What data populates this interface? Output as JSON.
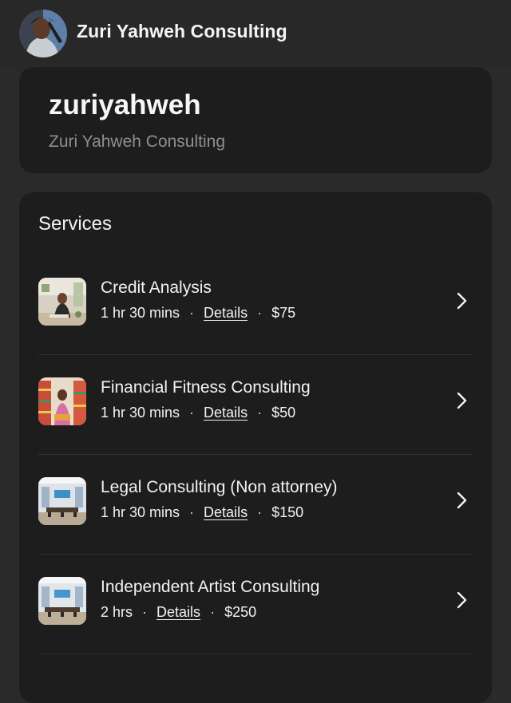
{
  "header": {
    "business_name": "Zuri Yahweh Consulting",
    "avatar_icon": "profile-photo"
  },
  "profile": {
    "username": "zuriyahweh",
    "display_name": "Zuri Yahweh Consulting"
  },
  "services": {
    "heading": "Services",
    "items": [
      {
        "name": "Credit Analysis",
        "duration": "1 hr 30 mins",
        "details_label": "Details",
        "price": "$75",
        "thumb": "woman-in-office"
      },
      {
        "name": "Financial Fitness Consulting",
        "duration": "1 hr 30 mins",
        "details_label": "Details",
        "price": "$50",
        "thumb": "woman-in-store"
      },
      {
        "name": "Legal Consulting (Non attorney)",
        "duration": "1 hr 30 mins",
        "details_label": "Details",
        "price": "$150",
        "thumb": "conference-room"
      },
      {
        "name": "Independent Artist Consulting",
        "duration": "2 hrs",
        "details_label": "Details",
        "price": "$250",
        "thumb": "conference-room"
      }
    ],
    "separator": "·"
  },
  "colors": {
    "background": "#2a2a2a",
    "card": "#1d1d1d",
    "text": "#f2f2f2",
    "muted": "#8f8f8f"
  }
}
